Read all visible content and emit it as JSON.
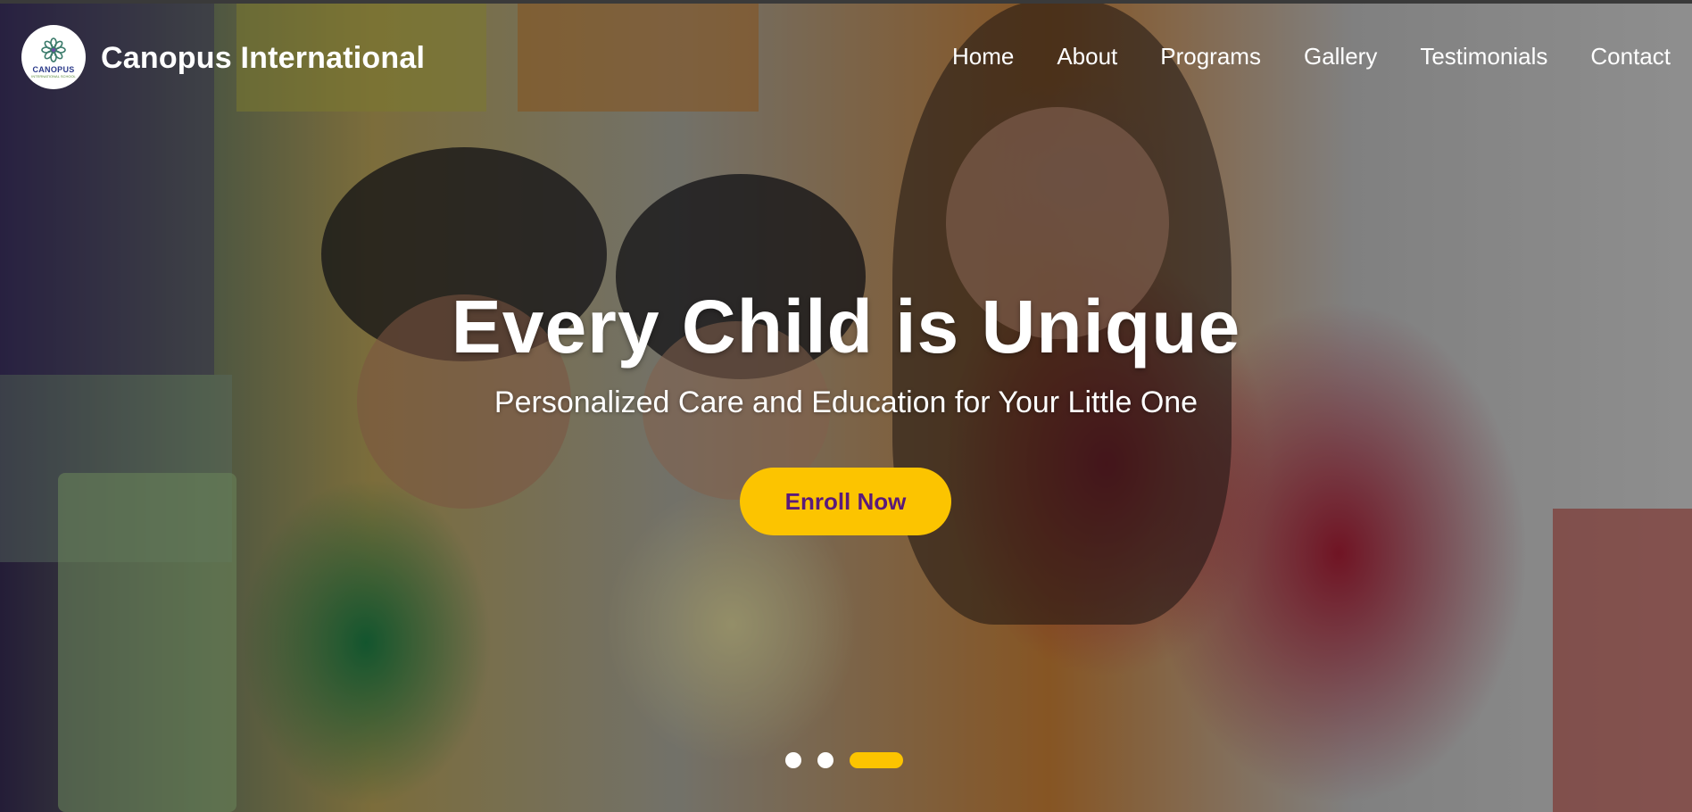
{
  "header": {
    "logo_text": "CANOPUS",
    "logo_subtext": "INTERNATIONAL SCHOOL",
    "brand": "Canopus International",
    "nav": [
      {
        "label": "Home"
      },
      {
        "label": "About"
      },
      {
        "label": "Programs"
      },
      {
        "label": "Gallery"
      },
      {
        "label": "Testimonials"
      },
      {
        "label": "Contact"
      }
    ]
  },
  "hero": {
    "title": "Every Child is Unique",
    "subtitle": "Personalized Care and Education for Your Little One",
    "cta_label": "Enroll Now",
    "slides_count": 3,
    "active_slide": 3
  },
  "colors": {
    "accent": "#fcc400",
    "cta_text": "#5a1a7a",
    "text": "#ffffff"
  }
}
